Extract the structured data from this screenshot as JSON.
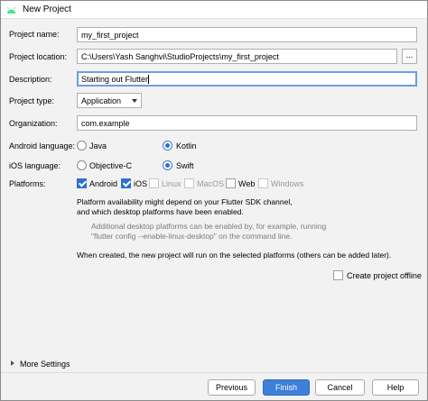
{
  "window": {
    "title": "New Project",
    "logo_icon": "android-icon"
  },
  "form": {
    "project_name": {
      "label": "Project name:",
      "value": "my_first_project"
    },
    "project_location": {
      "label": "Project location:",
      "value": "C:\\Users\\Yash Sanghvi\\StudioProjects\\my_first_project",
      "browse_label": "..."
    },
    "description": {
      "label": "Description:",
      "value": "Starting out Flutter"
    },
    "project_type": {
      "label": "Project type:",
      "value": "Application"
    },
    "organization": {
      "label": "Organization:",
      "value": "com.example"
    },
    "android_language": {
      "label": "Android language:",
      "options": [
        "Java",
        "Kotlin"
      ],
      "selected": "Kotlin"
    },
    "ios_language": {
      "label": "iOS language:",
      "options": [
        "Objective-C",
        "Swift"
      ],
      "selected": "Swift"
    },
    "platforms": {
      "label": "Platforms:",
      "items": [
        {
          "name": "Android",
          "checked": true,
          "enabled": true
        },
        {
          "name": "iOS",
          "checked": true,
          "enabled": true
        },
        {
          "name": "Linux",
          "checked": false,
          "enabled": false
        },
        {
          "name": "MacOS",
          "checked": false,
          "enabled": false
        },
        {
          "name": "Web",
          "checked": false,
          "enabled": true
        },
        {
          "name": "Windows",
          "checked": false,
          "enabled": false
        }
      ]
    }
  },
  "notes": {
    "availability_line1": "Platform availability might depend on your Flutter SDK channel,",
    "availability_line2": "and which desktop platforms have been enabled.",
    "desktop_line1": "Additional desktop platforms can be enabled by, for example, running",
    "desktop_line2": "\"flutter config --enable-linux-desktop\" on the command line.",
    "created_note": "When created, the new project will run on the selected platforms (others can be added later)."
  },
  "offline": {
    "label": "Create project offline",
    "checked": false
  },
  "more_settings": {
    "label": "More Settings"
  },
  "buttons": {
    "previous": "Previous",
    "finish": "Finish",
    "cancel": "Cancel",
    "help": "Help"
  },
  "colors": {
    "accent": "#3d7fd9",
    "focus_border": "#6a9de3"
  }
}
